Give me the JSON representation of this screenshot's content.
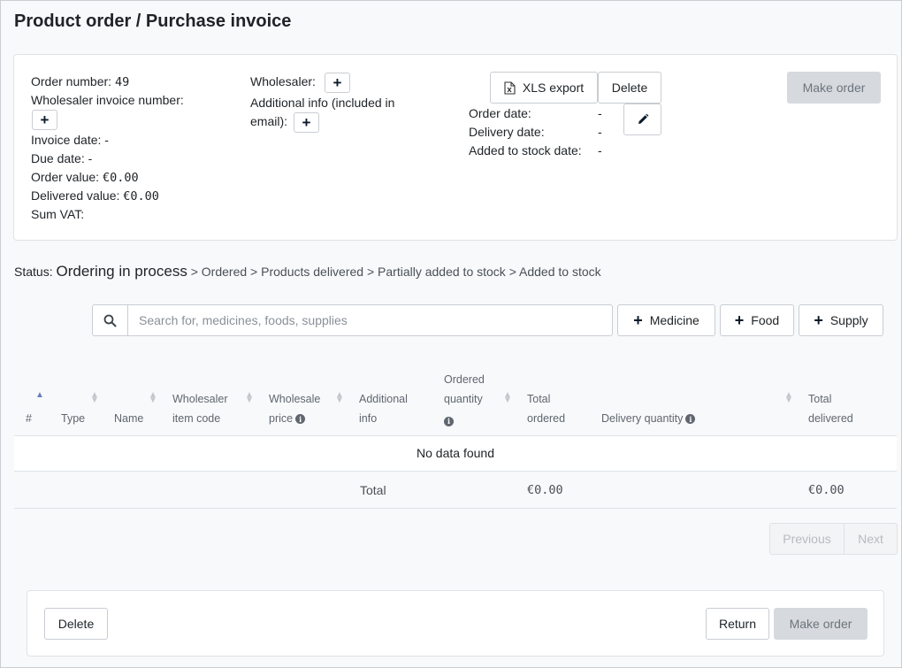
{
  "page_title": "Product order / Purchase invoice",
  "order": {
    "order_number_label": "Order number:",
    "order_number": "49",
    "wholesaler_invoice_label": "Wholesaler invoice number:",
    "invoice_date_label": "Invoice date:",
    "invoice_date": "-",
    "due_date_label": "Due date:",
    "due_date": "-",
    "order_value_label": "Order value:",
    "order_value": "€0.00",
    "delivered_value_label": "Delivered value:",
    "delivered_value": "€0.00",
    "sum_vat_label": "Sum VAT:",
    "wholesaler_label": "Wholesaler:",
    "additional_info_label_1": "Additional info (included in",
    "additional_info_label_2": "email):",
    "order_date_label": "Order date:",
    "order_date": "-",
    "delivery_date_label": "Delivery date:",
    "delivery_date": "-",
    "added_to_stock_label": "Added to stock date:",
    "added_to_stock": "-"
  },
  "actions": {
    "xls_export": "XLS export",
    "delete": "Delete",
    "make_order": "Make order"
  },
  "status": {
    "label": "Status:",
    "current": "Ordering in process",
    "steps": [
      "Ordered",
      "Products delivered",
      "Partially added to stock",
      "Added to stock"
    ],
    "separator": ">"
  },
  "search": {
    "placeholder": "Search for, medicines, foods, supplies"
  },
  "add_buttons": {
    "medicine": "Medicine",
    "food": "Food",
    "supply": "Supply"
  },
  "table": {
    "columns": {
      "num": "#",
      "type": "Type",
      "name": "Name",
      "wholesaler_code_1": "Wholesaler",
      "wholesaler_code_2": "item code",
      "wholesale_price_1": "Wholesale",
      "wholesale_price_2": "price",
      "additional_info_1": "Additional",
      "additional_info_2": "info",
      "ordered_qty_1": "Ordered",
      "ordered_qty_2": "quantity",
      "total_ordered_1": "Total",
      "total_ordered_2": "ordered",
      "delivery_qty": "Delivery quantity",
      "total_delivered_1": "Total",
      "total_delivered_2": "delivered"
    },
    "empty_message": "No data found",
    "total_label": "Total",
    "total_ordered": "€0.00",
    "total_delivered": "€0.00"
  },
  "pagination": {
    "previous": "Previous",
    "next": "Next"
  },
  "footer": {
    "delete": "Delete",
    "return": "Return",
    "make_order": "Make order"
  }
}
